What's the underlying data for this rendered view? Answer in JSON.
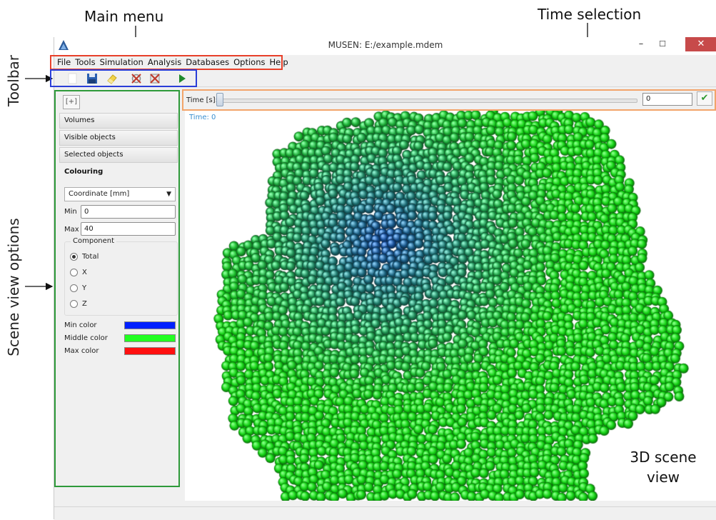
{
  "annotations": {
    "main_menu": "Main menu",
    "time_selection": "Time selection",
    "toolbar": "Toolbar",
    "scene_view_options": "Scene view options",
    "scene_view_line1": "3D scene",
    "scene_view_line2": "view"
  },
  "window": {
    "title": "MUSEN:  E:/example.mdem",
    "minimize": "–",
    "maximize": "☐",
    "close": "✕"
  },
  "menu": [
    "File",
    "Tools",
    "Simulation",
    "Analysis",
    "Databases",
    "Options",
    "Help"
  ],
  "toolbar": {
    "icons": [
      "new-file-icon",
      "save-icon",
      "eraser-icon",
      "clear-results-icon",
      "clear-all-icon",
      "play-icon"
    ]
  },
  "panel": {
    "fit_button": "[+]",
    "sections": [
      "Volumes",
      "Visible objects",
      "Selected objects",
      "Colouring"
    ],
    "coloring_mode": "Coordinate [mm]",
    "min_label": "Min",
    "min_value": "0",
    "max_label": "Max",
    "max_value": "40",
    "component_title": "Component",
    "components": [
      "Total",
      "X",
      "Y",
      "Z"
    ],
    "selected_component": "Total",
    "min_color_label": "Min color",
    "middle_color_label": "Middle color",
    "max_color_label": "Max color",
    "min_color": "#0020ff",
    "middle_color": "#22ff22",
    "max_color": "#ff1010"
  },
  "time": {
    "label": "Time [s]:",
    "value": "0",
    "overlay": "Time: 0",
    "slider_position": 0
  },
  "colors": {
    "menu_highlight": "#e8402a",
    "toolbar_highlight": "#2a3ed8",
    "time_highlight": "#f2a46a",
    "panel_highlight": "#2e9a3a"
  }
}
